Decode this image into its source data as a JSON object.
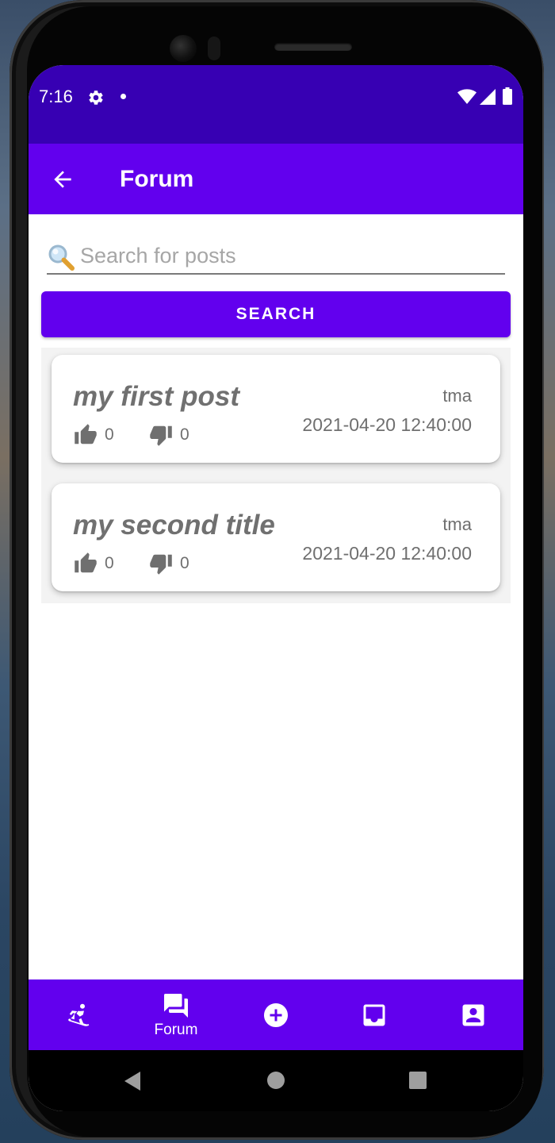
{
  "status_bar": {
    "time": "7:16",
    "icons": [
      "gear-icon",
      "notification-dot",
      "wifi-icon",
      "signal-icon",
      "battery-icon"
    ]
  },
  "app_bar": {
    "title": "Forum",
    "back_icon": "arrow-back-icon"
  },
  "search": {
    "placeholder": "Search for posts",
    "value": "",
    "button_label": "SEARCH"
  },
  "posts": [
    {
      "title": "my first post",
      "author": "tma",
      "date": "2021-04-20 12:40:00",
      "likes": "0",
      "dislikes": "0"
    },
    {
      "title": "my second title",
      "author": "tma",
      "date": "2021-04-20 12:40:00",
      "likes": "0",
      "dislikes": "0"
    }
  ],
  "bottom_nav": {
    "items": [
      {
        "icon": "snowboarding-icon",
        "label": ""
      },
      {
        "icon": "forum-icon",
        "label": "Forum",
        "active": true
      },
      {
        "icon": "add-circle-icon",
        "label": ""
      },
      {
        "icon": "inbox-icon",
        "label": ""
      },
      {
        "icon": "account-box-icon",
        "label": ""
      }
    ]
  },
  "colors": {
    "primary": "#6200ee",
    "primary_dark": "#3700b3",
    "text_secondary": "#6f6f6f"
  }
}
